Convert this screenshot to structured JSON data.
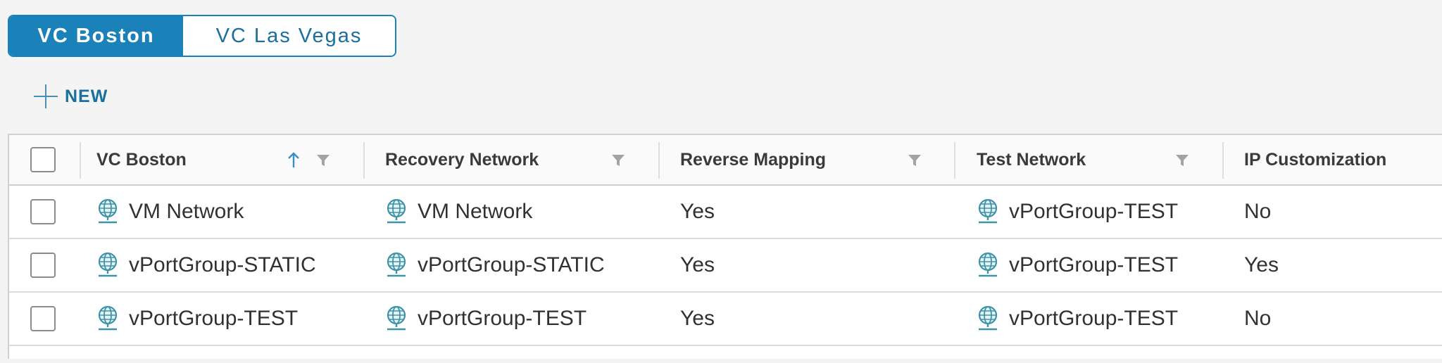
{
  "tabs": [
    {
      "label": "VC Boston",
      "active": true
    },
    {
      "label": "VC Las Vegas",
      "active": false
    }
  ],
  "toolbar": {
    "new_label": "NEW"
  },
  "table": {
    "columns": [
      {
        "label": "VC Boston",
        "sorted": "ascending",
        "filter": true
      },
      {
        "label": "Recovery Network",
        "filter": true
      },
      {
        "label": "Reverse Mapping",
        "filter": true
      },
      {
        "label": "Test Network",
        "filter": true
      },
      {
        "label": "IP Customization",
        "filter": false
      }
    ],
    "rows": [
      {
        "vc": "VM Network",
        "recovery": "VM Network",
        "reverse": "Yes",
        "test": "vPortGroup-TEST",
        "ip": "No"
      },
      {
        "vc": "vPortGroup-STATIC",
        "recovery": "vPortGroup-STATIC",
        "reverse": "Yes",
        "test": "vPortGroup-TEST",
        "ip": "Yes"
      },
      {
        "vc": "vPortGroup-TEST",
        "recovery": "vPortGroup-TEST",
        "reverse": "Yes",
        "test": "vPortGroup-TEST",
        "ip": "No"
      }
    ]
  },
  "icons": {
    "column_network": "network-globe-icon",
    "filter": "filter-icon",
    "sort": "sort-ascending-icon",
    "add": "plus-icon"
  },
  "colors": {
    "accent": "#1a82b8",
    "icon_teal": "#3d94a8"
  }
}
